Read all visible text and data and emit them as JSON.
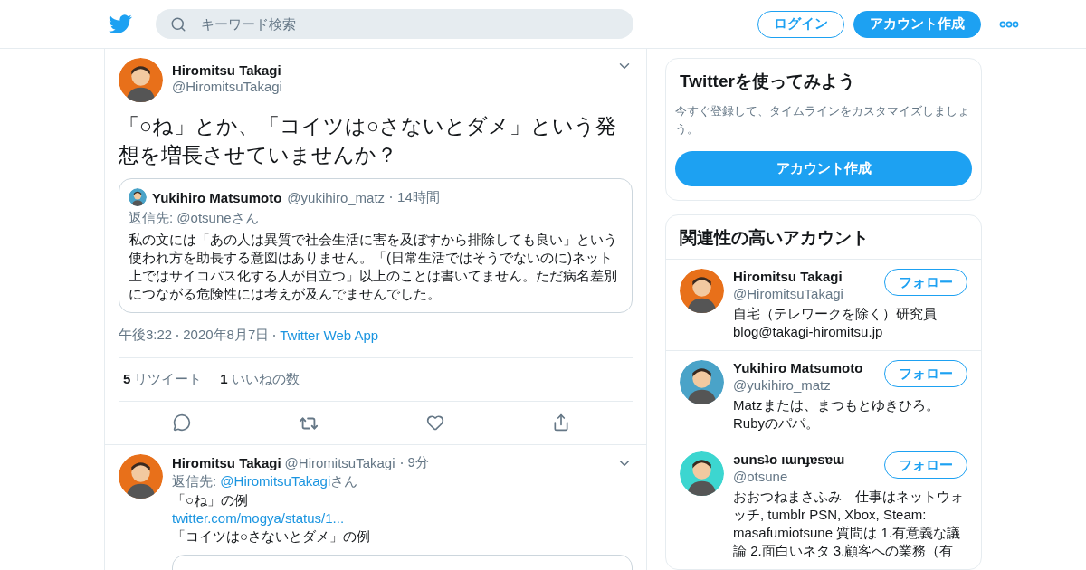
{
  "header": {
    "search": {
      "placeholder": "キーワード検索"
    },
    "login": "ログイン",
    "signup": "アカウント作成"
  },
  "tweet": {
    "name": "Hiromitsu Takagi",
    "handle": "@HiromitsuTakagi",
    "text": "「○ね」とか、「コイツは○さないとダメ」という発想を増長させていませんか？",
    "quote": {
      "name": "Yukihiro Matsumoto",
      "handle": "@yukihiro_matz",
      "time": "14時間",
      "reply_to": "返信先: @otsuneさん",
      "text": "私の文には「あの人は異質で社会生活に害を及ぼすから排除しても良い」という使われ方を助長する意図はありません。「(日常生活ではそうでないのに)ネット上ではサイコパス化する人が目立つ」以上のことは書いてません。ただ病名差別につながる危険性には考えが及んでませんでした。"
    },
    "time": "午後3:22",
    "date": "2020年8月7日",
    "source": "Twitter Web App",
    "stats": [
      {
        "count": "5",
        "label": "リツイート"
      },
      {
        "count": "1",
        "label": "いいねの数"
      }
    ]
  },
  "reply": {
    "name": "Hiromitsu Takagi",
    "handle": "@HiromitsuTakagi",
    "time": "9分",
    "reply_prefix": "返信先:",
    "reply_handle": "@HiromitsuTakagi",
    "reply_suffix": "さん",
    "lines": [
      {
        "kind": "text",
        "text": "「○ね」の例"
      },
      {
        "kind": "link",
        "text": "twitter.com/mogya/status/1..."
      },
      {
        "kind": "text",
        "text": "「コイツは○さないとダメ」の例"
      }
    ]
  },
  "signup_card": {
    "title": "Twitterを使ってみよう",
    "text": "今すぐ登録して、タイムラインをカスタマイズしましょう。",
    "button": "アカウント作成"
  },
  "accounts": {
    "title": "関連性の高いアカウント",
    "items": [
      {
        "name": "Hiromitsu Takagi",
        "handle": "@HiromitsuTakagi",
        "bio": "自宅（テレワークを除く）研究員\nblog@takagi-hiromitsu.jp",
        "follow": "フォロー"
      },
      {
        "name": "Yukihiro Matsumoto",
        "handle": "@yukihiro_matz",
        "bio": "Matzまたは、まつもとゆきひろ。\nRubyのパパ。",
        "follow": "フォロー"
      },
      {
        "name": "ǝunsʇo ıɯnɟɐsɐɯ",
        "handle": "@otsune",
        "bio": "おおつねまさふみ　仕事はネットウォッチ, tumblr PSN, Xbox, Steam: masafumiotsune 質問は 1.有意義な議論 2.面白いネタ 3.顧客への業務（有",
        "follow": "フォロー"
      }
    ]
  }
}
